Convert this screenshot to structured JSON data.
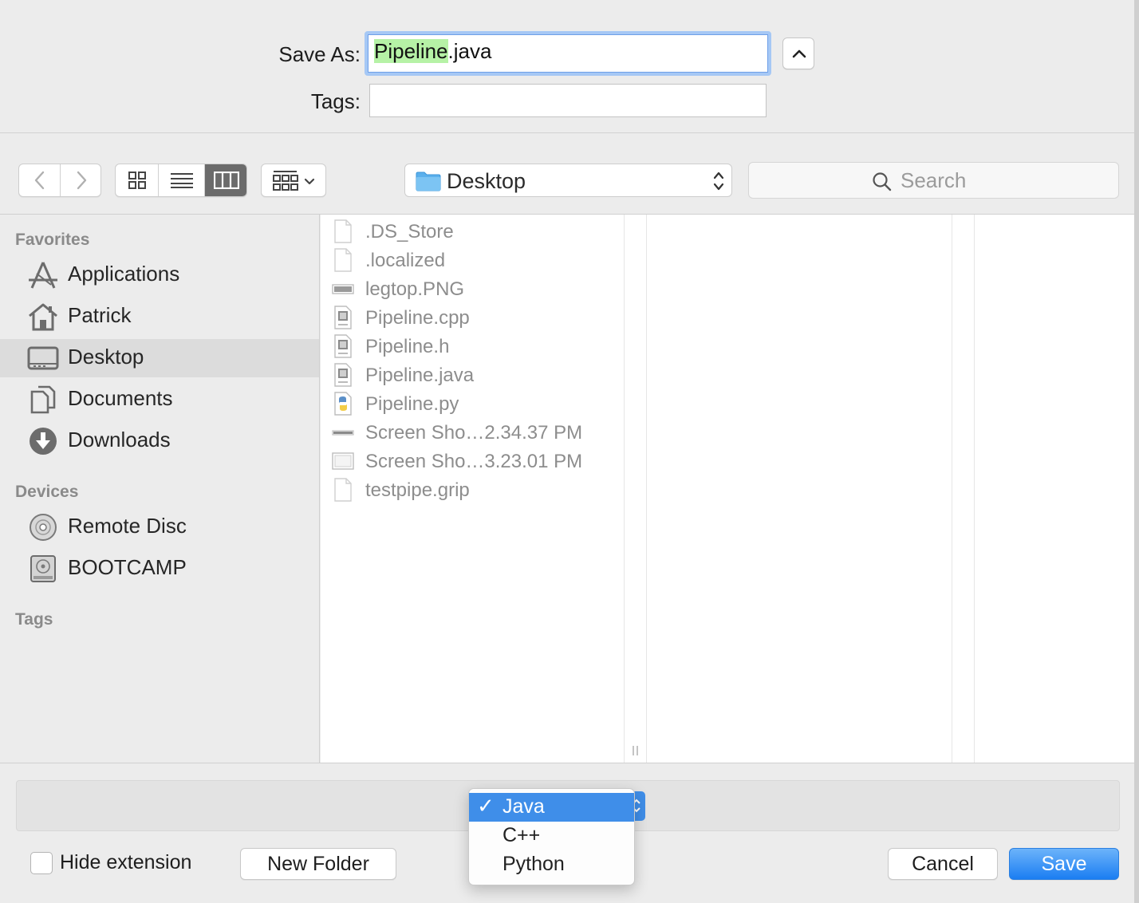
{
  "save_as": {
    "label": "Save As:",
    "filename_selected": "Pipeline",
    "filename_ext": ".java",
    "tags_label": "Tags:",
    "tags_value": ""
  },
  "toolbar": {
    "location": "Desktop",
    "search_placeholder": "Search"
  },
  "sidebar": {
    "favorites_title": "Favorites",
    "favorites": [
      {
        "label": "Applications",
        "icon": "applications-icon"
      },
      {
        "label": "Patrick",
        "icon": "home-icon"
      },
      {
        "label": "Desktop",
        "icon": "desktop-icon",
        "active": true
      },
      {
        "label": "Documents",
        "icon": "documents-icon"
      },
      {
        "label": "Downloads",
        "icon": "downloads-icon"
      }
    ],
    "devices_title": "Devices",
    "devices": [
      {
        "label": "Remote Disc",
        "icon": "disc-icon"
      },
      {
        "label": "BOOTCAMP",
        "icon": "drive-icon"
      }
    ],
    "tags_title": "Tags"
  },
  "files": [
    {
      "name": ".DS_Store",
      "icon": "blank-file-icon"
    },
    {
      "name": ".localized",
      "icon": "blank-file-icon"
    },
    {
      "name": "legtop.PNG",
      "icon": "image-file-icon"
    },
    {
      "name": "Pipeline.cpp",
      "icon": "cpp-file-icon"
    },
    {
      "name": "Pipeline.h",
      "icon": "header-file-icon"
    },
    {
      "name": "Pipeline.java",
      "icon": "java-file-icon"
    },
    {
      "name": "Pipeline.py",
      "icon": "python-file-icon"
    },
    {
      "name": "Screen Sho…2.34.37 PM",
      "icon": "screenshot-file-icon"
    },
    {
      "name": "Screen Sho…3.23.01 PM",
      "icon": "screenshot-file-icon"
    },
    {
      "name": "testpipe.grip",
      "icon": "blank-file-icon"
    }
  ],
  "format_menu": {
    "checkmark": "✓",
    "items": [
      "Java",
      "C++",
      "Python"
    ],
    "selected": "Java"
  },
  "bottom": {
    "hide_extension": "Hide extension",
    "new_folder": "New Folder",
    "cancel": "Cancel",
    "save": "Save"
  },
  "colors": {
    "accent": "#3f8ee9",
    "selection_highlight": "#b6f2a6",
    "save_button": "#1b7ef2"
  }
}
